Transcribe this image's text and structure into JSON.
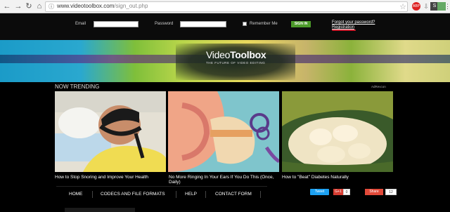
{
  "browser": {
    "url_host": "www.videotoolbox.com",
    "url_path": "/sign_out.php",
    "icons": [
      "back-icon",
      "forward-icon",
      "reload-icon",
      "home-icon",
      "lock-icon",
      "star-icon",
      "adblock-icon",
      "download-icon",
      "ext-s-icon",
      "ext-photo-icon",
      "menu-icon"
    ]
  },
  "login": {
    "email_label": "Email",
    "password_label": "Password",
    "remember_label": "Remember Me",
    "signin_label": "SIGN IN",
    "forgot_label": "Forgot your password?",
    "register_label": "Registration"
  },
  "banner": {
    "logo_a": "Video",
    "logo_b": "Toolbox",
    "tagline": "THE FUTURE OF VIDEO EDITING"
  },
  "trending": {
    "heading": "NOW TRENDING",
    "ad_label": "AdRevcon",
    "items": [
      {
        "caption": "How to Stop Snoring and Improve Your Health"
      },
      {
        "caption": "No More Ringing In Your Ears If You Do This (Once, Daily)"
      },
      {
        "caption": "How to \"Beat\" Diabetes Naturally"
      }
    ]
  },
  "nav": {
    "items": [
      "HOME",
      "CODECS AND FILE FORMATS",
      "HELP",
      "CONTACT FORM"
    ]
  },
  "social": {
    "tweet": "Tweet",
    "gplus": "G+1",
    "gplus_count": "0",
    "share": "Share",
    "share_count": "12"
  },
  "colors": {
    "signin_bg": "#4c9a2a",
    "underline": "#d21e2e",
    "tweet_bg": "#1da1f2",
    "share_bg": "#e24a3a"
  }
}
